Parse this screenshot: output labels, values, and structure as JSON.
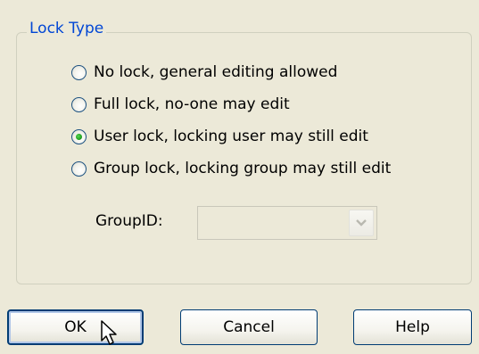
{
  "lock_type": {
    "legend": "Lock Type",
    "options": [
      {
        "label": "No lock, general editing allowed",
        "checked": false
      },
      {
        "label": "Full lock, no-one may edit",
        "checked": false
      },
      {
        "label": "User lock, locking user may still edit",
        "checked": true
      },
      {
        "label": "Group lock, locking group may still edit",
        "checked": false
      }
    ],
    "groupid_label": "GroupID:",
    "groupid_value": "",
    "groupid_enabled": false
  },
  "buttons": {
    "ok": "OK",
    "cancel": "Cancel",
    "help": "Help"
  },
  "colors": {
    "legend": "#0046D5",
    "dialog_bg": "#ECE9D8",
    "button_border": "#003C74",
    "radio_dot": "#21A121"
  },
  "icons": {
    "dropdown": "chevron-down-icon",
    "cursor": "mouse-pointer-icon"
  }
}
